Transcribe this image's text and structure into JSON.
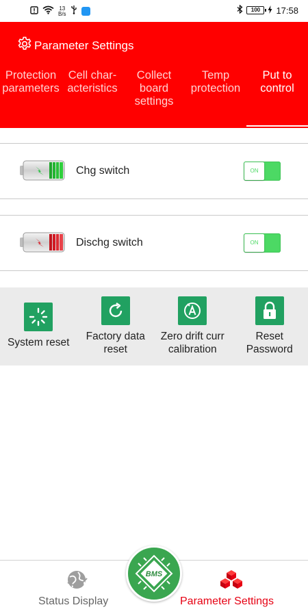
{
  "status_bar": {
    "net_speed_value": "13",
    "net_speed_unit": "B/s",
    "battery_level": "100",
    "time": "17:58"
  },
  "header": {
    "title": "Parameter Settings",
    "tabs": [
      {
        "label_line1": "Protection",
        "label_line2": "parameters",
        "label_line3": ""
      },
      {
        "label_line1": "Cell char-",
        "label_line2": "acteristics",
        "label_line3": ""
      },
      {
        "label_line1": "Collect",
        "label_line2": "board",
        "label_line3": "settings"
      },
      {
        "label_line1": "Temp",
        "label_line2": "protection",
        "label_line3": ""
      },
      {
        "label_line1": "Put to",
        "label_line2": "control",
        "label_line3": ""
      }
    ],
    "active_tab_index": 4
  },
  "switches": [
    {
      "label": "Chg switch",
      "state": "ON",
      "battery_color": "#22c03a"
    },
    {
      "label": "Dischg switch",
      "state": "ON",
      "battery_color": "#d8202a"
    }
  ],
  "actions": [
    {
      "line1": "System reset",
      "line2": "",
      "icon": "spinner-icon"
    },
    {
      "line1": "Factory data",
      "line2": "reset",
      "icon": "refresh-icon"
    },
    {
      "line1": "Zero drift curr",
      "line2": "calibration",
      "icon": "calibration-icon"
    },
    {
      "line1": "Reset",
      "line2": "Password",
      "icon": "lock-icon"
    }
  ],
  "bottom_nav": {
    "left_label": "Status Display",
    "right_label": "Parameter Settings",
    "center_label": "BMS",
    "active": "Parameter Settings"
  },
  "colors": {
    "header_red": "#ff0000",
    "toggle_green": "#4cd964",
    "action_green": "#21a161",
    "nav_active_red": "#e60012"
  }
}
